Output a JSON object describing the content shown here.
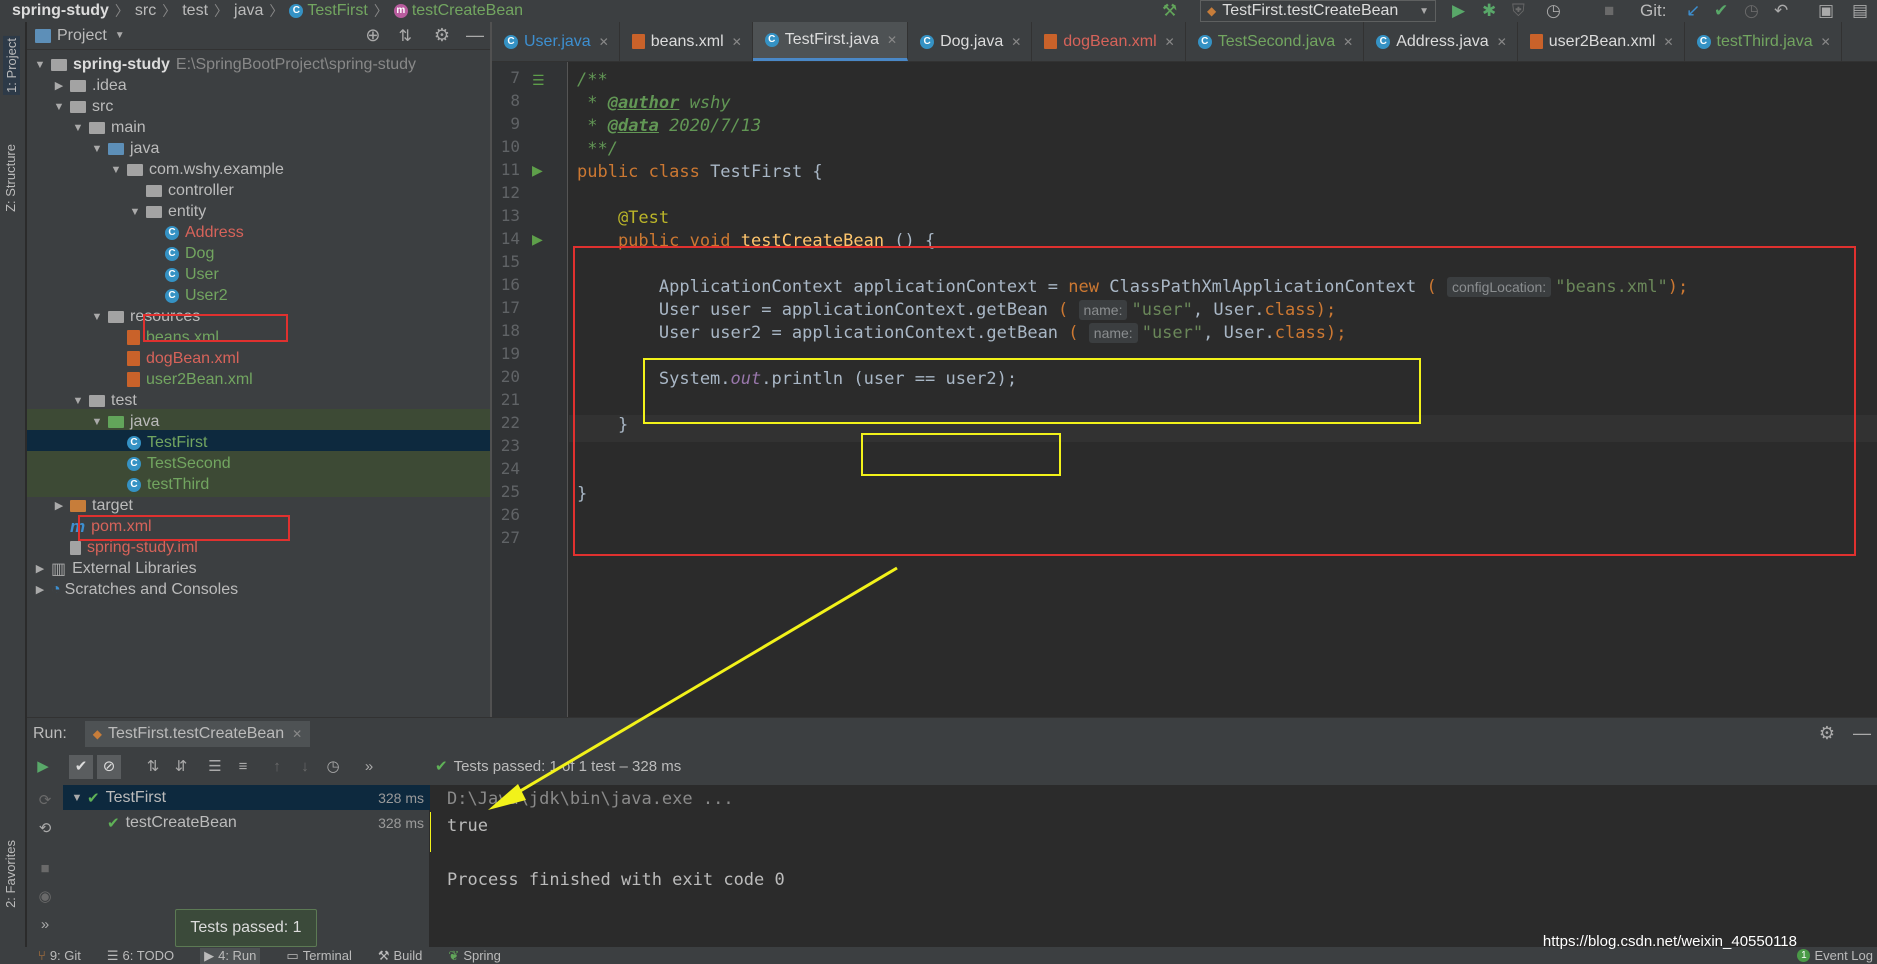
{
  "navbar": {
    "crumbs": [
      "spring-study",
      "src",
      "test",
      "java",
      "TestFirst",
      "testCreateBean"
    ]
  },
  "toolbar": {
    "run_config": "TestFirst.testCreateBean",
    "git_label": "Git:"
  },
  "left_strip": {
    "project_tab": "1: Project",
    "structure_tab": "Z: Structure",
    "favorites_tab": "2: Favorites"
  },
  "project_panel": {
    "title": "Project",
    "tree": [
      {
        "label": "spring-study",
        "path": "E:\\SpringBootProject\\spring-study"
      },
      {
        "label": ".idea"
      },
      {
        "label": "src"
      },
      {
        "label": "main"
      },
      {
        "label": "java"
      },
      {
        "label": "com.wshy.example"
      },
      {
        "label": "controller"
      },
      {
        "label": "entity"
      },
      {
        "label": "Address"
      },
      {
        "label": "Dog"
      },
      {
        "label": "User"
      },
      {
        "label": "User2"
      },
      {
        "label": "resources"
      },
      {
        "label": "beans.xml"
      },
      {
        "label": "dogBean.xml"
      },
      {
        "label": "user2Bean.xml"
      },
      {
        "label": "test"
      },
      {
        "label": "java"
      },
      {
        "label": "TestFirst"
      },
      {
        "label": "TestSecond"
      },
      {
        "label": "testThird"
      },
      {
        "label": "target"
      },
      {
        "label": "pom.xml"
      },
      {
        "label": "spring-study.iml"
      },
      {
        "label": "External Libraries"
      },
      {
        "label": "Scratches and Consoles"
      }
    ]
  },
  "tabs": [
    {
      "label": "User.java"
    },
    {
      "label": "beans.xml"
    },
    {
      "label": "TestFirst.java"
    },
    {
      "label": "Dog.java"
    },
    {
      "label": "dogBean.xml"
    },
    {
      "label": "TestSecond.java"
    },
    {
      "label": "Address.java"
    },
    {
      "label": "user2Bean.xml"
    },
    {
      "label": "testThird.java"
    }
  ],
  "editor": {
    "line_numbers": [
      "7",
      "8",
      "9",
      "10",
      "11",
      "12",
      "13",
      "14",
      "15",
      "16",
      "17",
      "18",
      "19",
      "20",
      "21",
      "22",
      "23",
      "24",
      "25",
      "26",
      "27"
    ],
    "code": {
      "l8": "/**",
      "l9_star": " * ",
      "l9_tag": "@author",
      "l9_val": " wshy",
      "l10_star": " * ",
      "l10_tag": "@data",
      "l10_val": " 2020/7/13",
      "l11": " **/",
      "l12_kw": "public class ",
      "l12_name": "TestFirst {",
      "l14": "    @Test",
      "l15_kw": "    public void ",
      "l15_fn": "testCreateBean",
      "l15_rest": " () {",
      "l17_a": "        ApplicationContext applicationContext = ",
      "l17_new": "new ",
      "l17_b": "ClassPathXmlApplicationContext ",
      "l17_paren": "(",
      "l17_hint": "configLocation:",
      "l17_str": "\"beans.xml\"",
      "l17_end": ");",
      "l18_a": "        User user = applicationContext.getBean ",
      "l18_paren": "(",
      "l18_hint": "name:",
      "l18_str": "\"user\"",
      "l18_b": ", User.",
      "l18_kw": "class",
      "l18_end": ");",
      "l19_a": "        User user2 = applicationContext.getBean ",
      "l19_paren": "(",
      "l19_hint": "name:",
      "l19_str": "\"user\"",
      "l19_b": ", User.",
      "l19_kw": "class",
      "l19_end": ");",
      "l21_a": "        System.",
      "l21_out": "out",
      "l21_b": ".println ",
      "l21_c": "(user == user2);",
      "l23": "    }",
      "l26": "}"
    }
  },
  "run_panel": {
    "label": "Run:",
    "tab": "TestFirst.testCreateBean",
    "status": "Tests passed: 1 of 1 test – 328 ms",
    "tree": [
      {
        "name": "TestFirst",
        "time": "328 ms"
      },
      {
        "name": "testCreateBean",
        "time": "328 ms"
      }
    ],
    "console": [
      "D:\\Java\\jdk\\bin\\java.exe ...",
      "true",
      "",
      "Process finished with exit code 0"
    ],
    "tooltip": "Tests passed: 1"
  },
  "statusbar": {
    "items": [
      "9: Git",
      "6: TODO",
      "4: Run",
      "Terminal",
      "Build",
      "Spring"
    ],
    "event_log": "Event Log",
    "event_count": "1"
  },
  "watermark": "https://blog.csdn.net/weixin_40550118",
  "colors": {
    "highlight_red": "#e0312f",
    "highlight_yellow": "#f2f21a",
    "pass_green": "#5fb257"
  }
}
